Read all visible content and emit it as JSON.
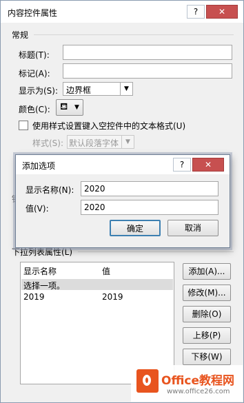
{
  "main": {
    "title": "内容控件属性",
    "help_glyph": "?",
    "close_glyph": "✕",
    "section_general": "常规",
    "title_label": "标题(T):",
    "title_value": "",
    "tag_label": "标记(A):",
    "tag_value": "",
    "show_as_label": "显示为(S):",
    "show_as_value": "边界框",
    "color_label": "颜色(C):",
    "use_style_label": "使用样式设置键入空控件中的文本格式(U)",
    "style_label": "样式(S):",
    "style_value": "默认段落字体",
    "hidden_char": "锁",
    "dropdown_props_label": "下拉列表属性(L)",
    "list_headers": [
      "显示名称",
      "值"
    ],
    "list_rows": [
      {
        "name": "选择一项。",
        "value": ""
      },
      {
        "name": "2019",
        "value": "2019"
      }
    ],
    "buttons": {
      "add": "添加(A)...",
      "modify": "修改(M)...",
      "delete": "删除(O)",
      "up": "上移(P)",
      "down": "下移(W)"
    }
  },
  "dialog": {
    "title": "添加选项",
    "help_glyph": "?",
    "close_glyph": "✕",
    "display_name_label": "显示名称(N):",
    "display_name_value": "2020",
    "value_label": "值(V):",
    "value_value": "2020",
    "ok": "确定",
    "cancel": "取消"
  },
  "watermark": {
    "brand": "Office教程网",
    "url": "www.office26.com"
  },
  "colors": {
    "accent": "#e8541e",
    "close": "#c75050",
    "selection": "#dcdcdc"
  }
}
